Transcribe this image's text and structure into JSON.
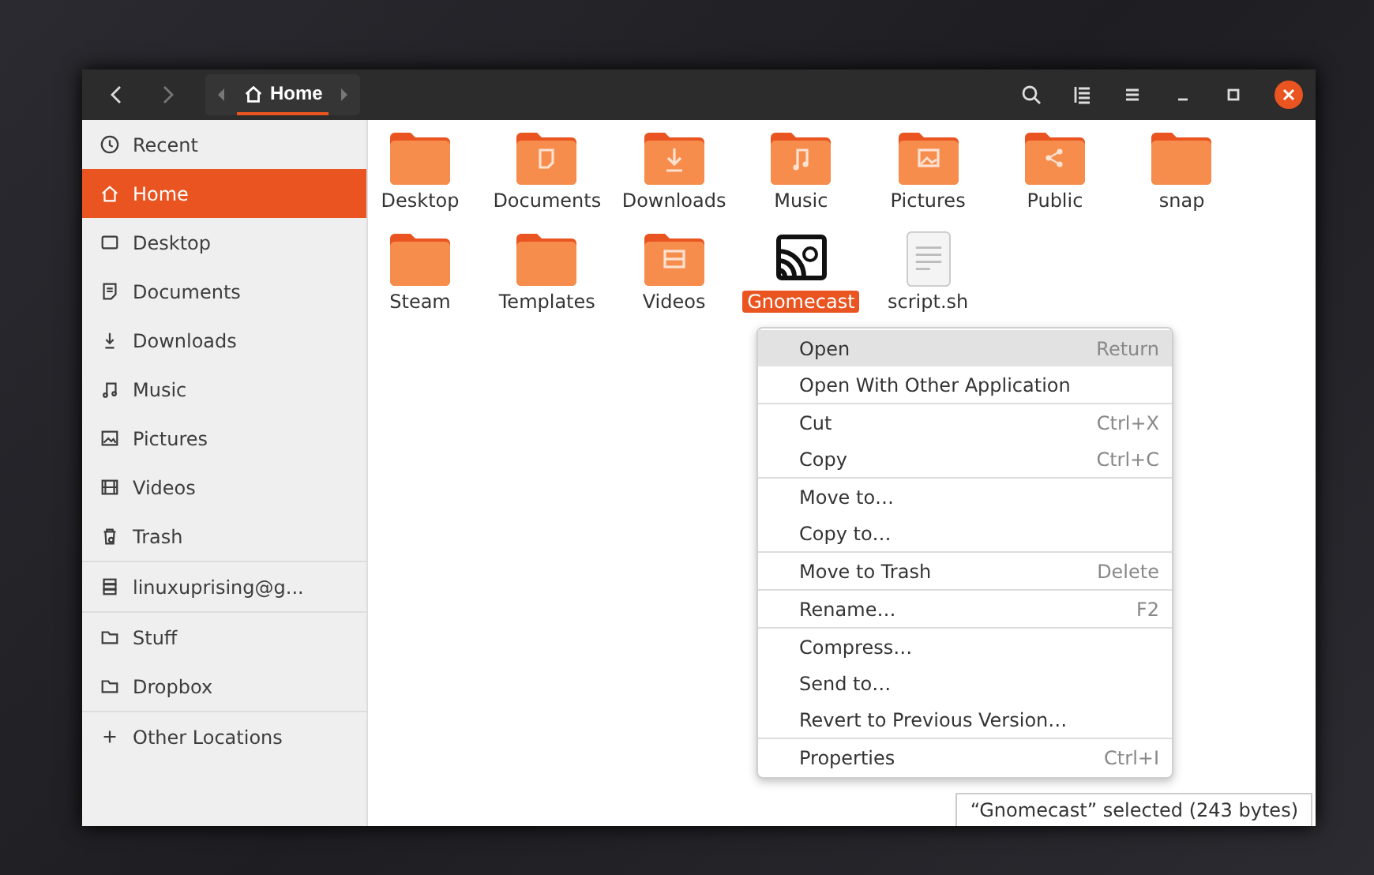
{
  "header": {
    "breadcrumbs": [
      {
        "label": "Home",
        "selected": true
      }
    ]
  },
  "sidebar": {
    "groups": [
      {
        "items": [
          {
            "label": "Recent",
            "selected": false
          },
          {
            "label": "Home",
            "selected": true
          },
          {
            "label": "Desktop",
            "selected": false
          },
          {
            "label": "Documents",
            "selected": false
          },
          {
            "label": "Downloads",
            "selected": false
          },
          {
            "label": "Music",
            "selected": false
          },
          {
            "label": "Pictures",
            "selected": false
          },
          {
            "label": "Videos",
            "selected": false
          },
          {
            "label": "Trash",
            "selected": false
          }
        ]
      },
      {
        "items": [
          {
            "label": "linuxuprising@g...",
            "selected": false
          }
        ]
      },
      {
        "items": [
          {
            "label": "Stuff",
            "selected": false
          },
          {
            "label": "Dropbox",
            "selected": false
          }
        ]
      },
      {
        "items": [
          {
            "label": "Other Locations",
            "selected": false
          }
        ]
      }
    ]
  },
  "files": [
    {
      "name": "Desktop",
      "kind": "folder",
      "selected": false
    },
    {
      "name": "Documents",
      "kind": "folder",
      "selected": false
    },
    {
      "name": "Downloads",
      "kind": "folder",
      "selected": false
    },
    {
      "name": "Music",
      "kind": "folder",
      "selected": false
    },
    {
      "name": "Pictures",
      "kind": "folder",
      "selected": false
    },
    {
      "name": "Public",
      "kind": "folder",
      "selected": false
    },
    {
      "name": "snap",
      "kind": "folder",
      "selected": false
    },
    {
      "name": "Steam",
      "kind": "folder",
      "selected": false
    },
    {
      "name": "Templates",
      "kind": "folder",
      "selected": false
    },
    {
      "name": "Videos",
      "kind": "folder",
      "selected": false
    },
    {
      "name": "Gnomecast",
      "kind": "app",
      "selected": true
    },
    {
      "name": "script.sh",
      "kind": "text",
      "selected": false
    }
  ],
  "context_menu": {
    "groups": [
      {
        "items": [
          {
            "label": "Open",
            "shortcut": "Return",
            "selected": true
          },
          {
            "label": "Open With Other Application",
            "selected": false
          }
        ]
      },
      {
        "items": [
          {
            "label": "Cut",
            "shortcut": "Ctrl+X",
            "selected": false
          },
          {
            "label": "Copy",
            "shortcut": "Ctrl+C",
            "selected": false
          }
        ]
      },
      {
        "items": [
          {
            "label": "Move to…",
            "selected": false
          },
          {
            "label": "Copy to…",
            "selected": false
          }
        ]
      },
      {
        "items": [
          {
            "label": "Move to Trash",
            "shortcut": "Delete",
            "selected": false
          }
        ]
      },
      {
        "items": [
          {
            "label": "Rename…",
            "shortcut": "F2",
            "selected": false
          }
        ]
      },
      {
        "items": [
          {
            "label": "Compress…",
            "selected": false
          },
          {
            "label": "Send to…",
            "selected": false
          },
          {
            "label": "Revert to Previous Version…",
            "selected": false
          }
        ]
      },
      {
        "items": [
          {
            "label": "Properties",
            "shortcut": "Ctrl+I",
            "selected": false
          }
        ]
      }
    ]
  },
  "status_bar": {
    "text": "“Gnomecast” selected (243 bytes)"
  }
}
